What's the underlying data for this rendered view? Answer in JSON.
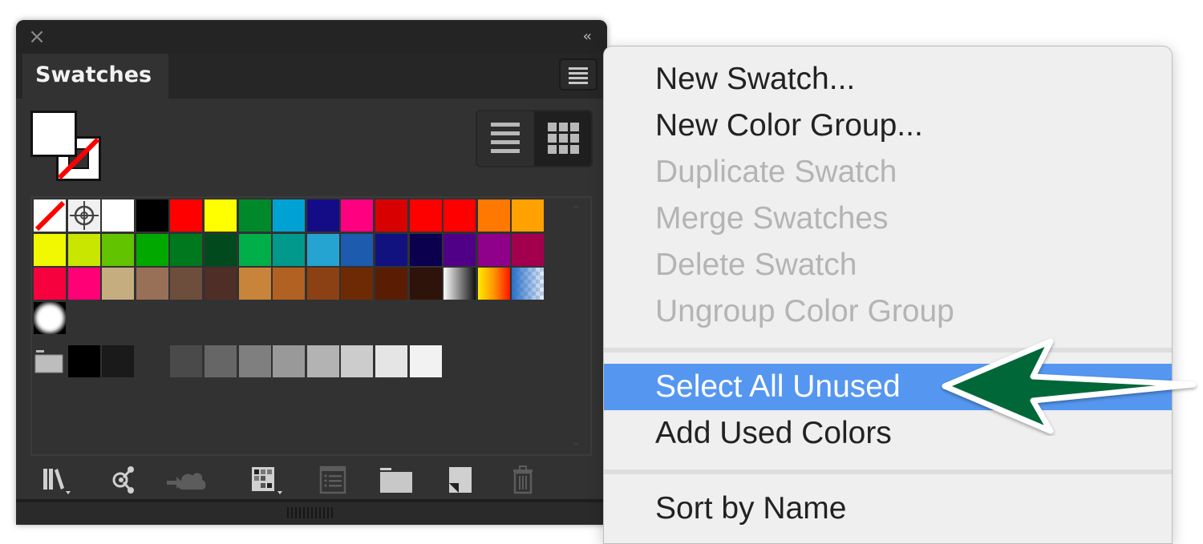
{
  "panel": {
    "close_icon": "×",
    "collapse_icon": "‹‹",
    "tab_label": "Swatches",
    "fill_color": "#ffffff",
    "stroke_color": "none",
    "view_modes": [
      "list-view",
      "thumbnail-view"
    ],
    "active_view": "thumbnail-view",
    "swatch_rows": [
      [
        "none",
        "registration",
        "#ffffff",
        "#000000",
        "#ff0000",
        "#ffff00",
        "#00892b",
        "#00a2d3",
        "#130c86",
        "#ff0080",
        "#d80000",
        "#fd0000",
        "#ff0000",
        "#ff7800",
        "#ffa100"
      ],
      [
        "#f2f800",
        "#c8e600",
        "#62c300",
        "#00a800",
        "#00781e",
        "#004a1d",
        "#00ae4a",
        "#00998c",
        "#25a4d2",
        "#1d5bae",
        "#11117f",
        "#0b004d",
        "#4f0087",
        "#8f008b",
        "#a2004e"
      ],
      [
        "#f6003d",
        "#ff0077",
        "#c6ad80",
        "#987058",
        "#6d4e3c",
        "#4e2e26",
        "#c8843a",
        "#b16222",
        "#8b4114",
        "#6e2a05",
        "#5a1d03",
        "#2e130a",
        "gradient-black-white",
        "gradient-yellow-red",
        "gradient-blue-transparent"
      ],
      [
        "pattern-radial"
      ]
    ],
    "grayscale_group": {
      "folder_icon": "folder-icon",
      "colors": [
        "#000000",
        "#1a1a1a",
        null,
        "#4a4a4a",
        "#666666",
        "#7f7f7f",
        "#999999",
        "#b3b3b3",
        "#cccccc",
        "#e5e5e5",
        "#f2f2f2"
      ]
    },
    "bottom_icons": [
      "swatch-libraries-menu-icon",
      "open-cc-libraries-icon",
      "add-to-library-icon",
      "show-swatch-kinds-menu-icon",
      "swatch-options-icon",
      "new-color-group-icon",
      "new-swatch-icon",
      "delete-swatch-icon"
    ]
  },
  "context_menu": {
    "items": [
      {
        "label": "New Swatch...",
        "state": "enabled"
      },
      {
        "label": "New Color Group...",
        "state": "enabled"
      },
      {
        "label": "Duplicate Swatch",
        "state": "disabled"
      },
      {
        "label": "Merge Swatches",
        "state": "disabled"
      },
      {
        "label": "Delete Swatch",
        "state": "disabled"
      },
      {
        "label": "Ungroup Color Group",
        "state": "disabled"
      },
      {
        "label": "Select All Unused",
        "state": "highlighted"
      },
      {
        "label": "Add Used Colors",
        "state": "enabled"
      },
      {
        "label": "Sort by Name",
        "state": "enabled"
      }
    ],
    "highlight_color": "#5597f0"
  },
  "annotation": {
    "type": "arrow-left",
    "color": "#006837",
    "points_to": "Select All Unused"
  }
}
